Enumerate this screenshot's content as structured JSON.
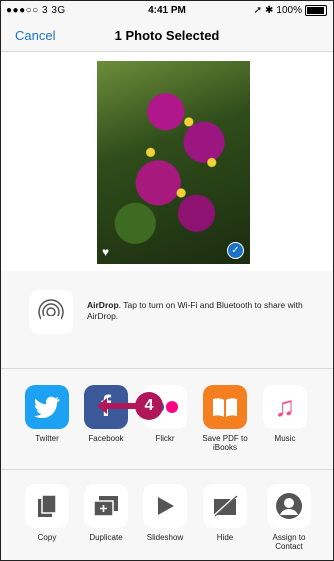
{
  "status_bar": {
    "carrier": "●●●○○ 3  3G",
    "time": "4:41 PM",
    "battery": "100%"
  },
  "nav": {
    "cancel_label": "Cancel",
    "title": "1 Photo Selected"
  },
  "airdrop": {
    "label_bold": "AirDrop",
    "description": ". Tap to turn on Wi-Fi and Bluetooth to share with AirDrop."
  },
  "share_row": [
    {
      "label": "Twitter",
      "icon": "twitter-icon"
    },
    {
      "label": "Facebook",
      "icon": "facebook-icon"
    },
    {
      "label": "Flickr",
      "icon": "flickr-icon"
    },
    {
      "label": "Save PDF to iBooks",
      "icon": "ibooks-icon"
    },
    {
      "label": "Music",
      "icon": "music-icon"
    }
  ],
  "action_row": [
    {
      "label": "Copy",
      "icon": "copy-icon"
    },
    {
      "label": "Duplicate",
      "icon": "duplicate-icon"
    },
    {
      "label": "Slideshow",
      "icon": "play-icon"
    },
    {
      "label": "Hide",
      "icon": "hide-icon"
    },
    {
      "label": "Assign to Contact",
      "icon": "contact-icon"
    }
  ],
  "callout": {
    "number": "4"
  },
  "colors": {
    "accent": "#1a73c6",
    "callout": "#b0175b",
    "twitter": "#1da1f2",
    "facebook": "#3b5998",
    "ibooks": "#f47f20"
  }
}
